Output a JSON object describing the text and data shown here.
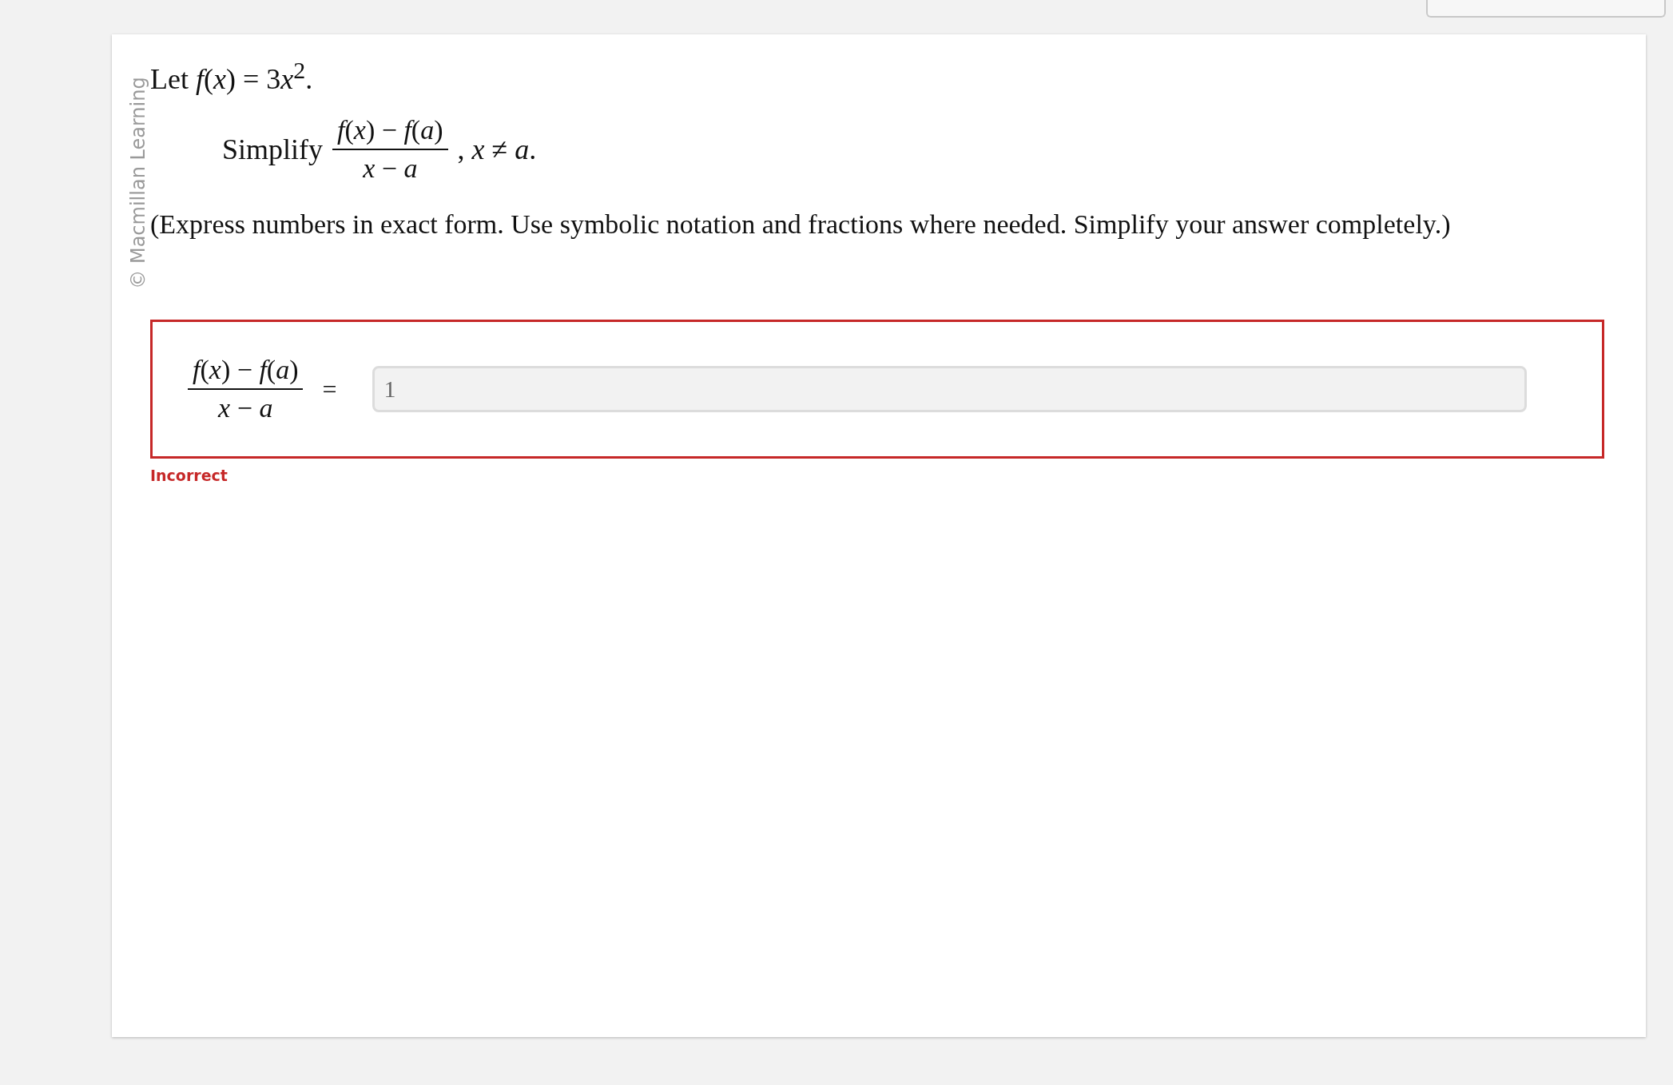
{
  "copyright": "© Macmillan Learning",
  "question": {
    "given": [
      "Let *f*(*x*) = 3",
      "*x*$^{2}$."
    ],
    "prompt": {
      "label": "Simplify",
      "numerator": "*f*(*x*) − *f*(*a*)",
      "denominator": "*x* − *a*",
      "suffix": ", *x* ≠ *a*."
    },
    "instructions": "(Express numbers in exact form. Use symbolic notation and fractions where needed. Simplify your answer completely.)"
  },
  "answer": {
    "numerator": "*f*(*x*) − *f*(*a*)",
    "denominator": "*x* − *a*",
    "equals": "=",
    "value": "1",
    "incorrect": true,
    "feedback": "Incorrect"
  }
}
